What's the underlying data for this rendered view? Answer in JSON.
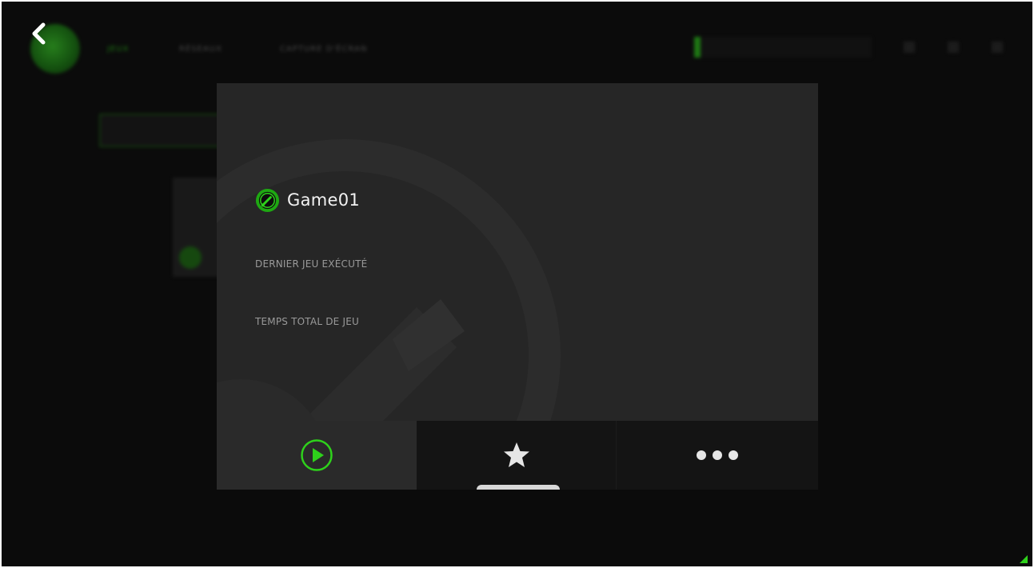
{
  "background": {
    "nav_items": [
      "JEUX",
      "RÉSEAUX",
      "CAPTURE D'ÉCRAN"
    ],
    "active_nav": "JEUX",
    "search_placeholder": ""
  },
  "modal": {
    "game_title": "Game01",
    "game_icon": "razer-cortex-icon",
    "stats": [
      {
        "label": "DERNIER JEU EXÉCUTÉ"
      },
      {
        "label": "TEMPS TOTAL DE JEU"
      }
    ],
    "actions": [
      {
        "name": "play",
        "icon": "play-circle-icon"
      },
      {
        "name": "favorite",
        "icon": "star-icon",
        "selected": true
      },
      {
        "name": "more",
        "icon": "more-dots-icon"
      }
    ]
  },
  "colors": {
    "accent": "#2ed11b",
    "modal_bg": "#262626",
    "action_bar_bg": "#141414",
    "app_bg": "#0b0b0b",
    "title_text": "#f2f2f2",
    "label_text": "#9a9a9a"
  }
}
